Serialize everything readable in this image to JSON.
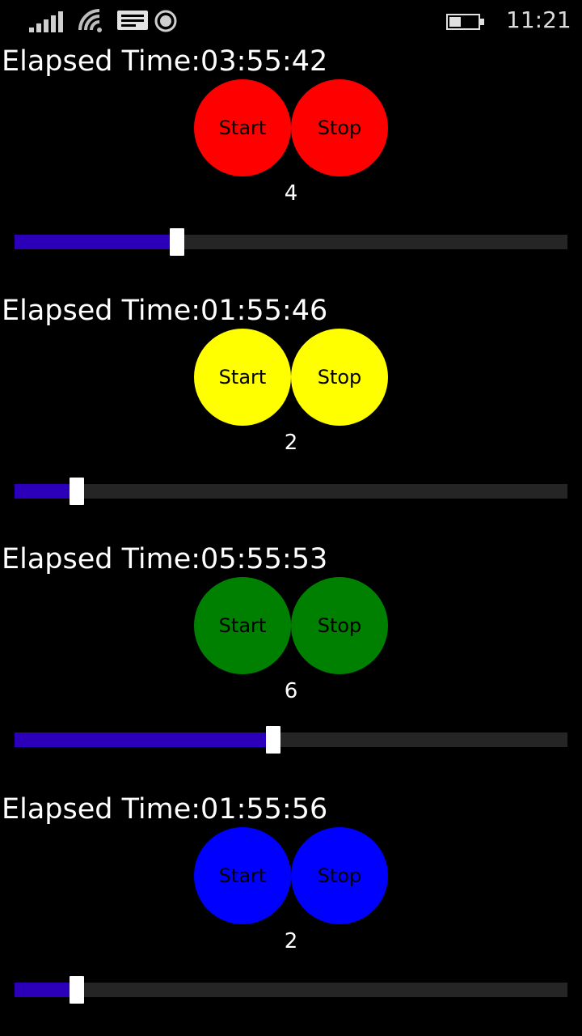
{
  "status": {
    "time": "11:21"
  },
  "timers": [
    {
      "elapsed": "Elapsed Time:03:55:42",
      "start_label": "Start",
      "stop_label": "Stop",
      "value": "4",
      "color": "#ff0000",
      "fraction": 0.28
    },
    {
      "elapsed": "Elapsed Time:01:55:46",
      "start_label": "Start",
      "stop_label": "Stop",
      "value": "2",
      "color": "#ffff00",
      "fraction": 0.1
    },
    {
      "elapsed": "Elapsed Time:05:55:53",
      "start_label": "Start",
      "stop_label": "Stop",
      "value": "6",
      "color": "#008000",
      "fraction": 0.455
    },
    {
      "elapsed": "Elapsed Time:01:55:56",
      "start_label": "Start",
      "stop_label": "Stop",
      "value": "2",
      "color": "#0000ff",
      "fraction": 0.1
    }
  ]
}
